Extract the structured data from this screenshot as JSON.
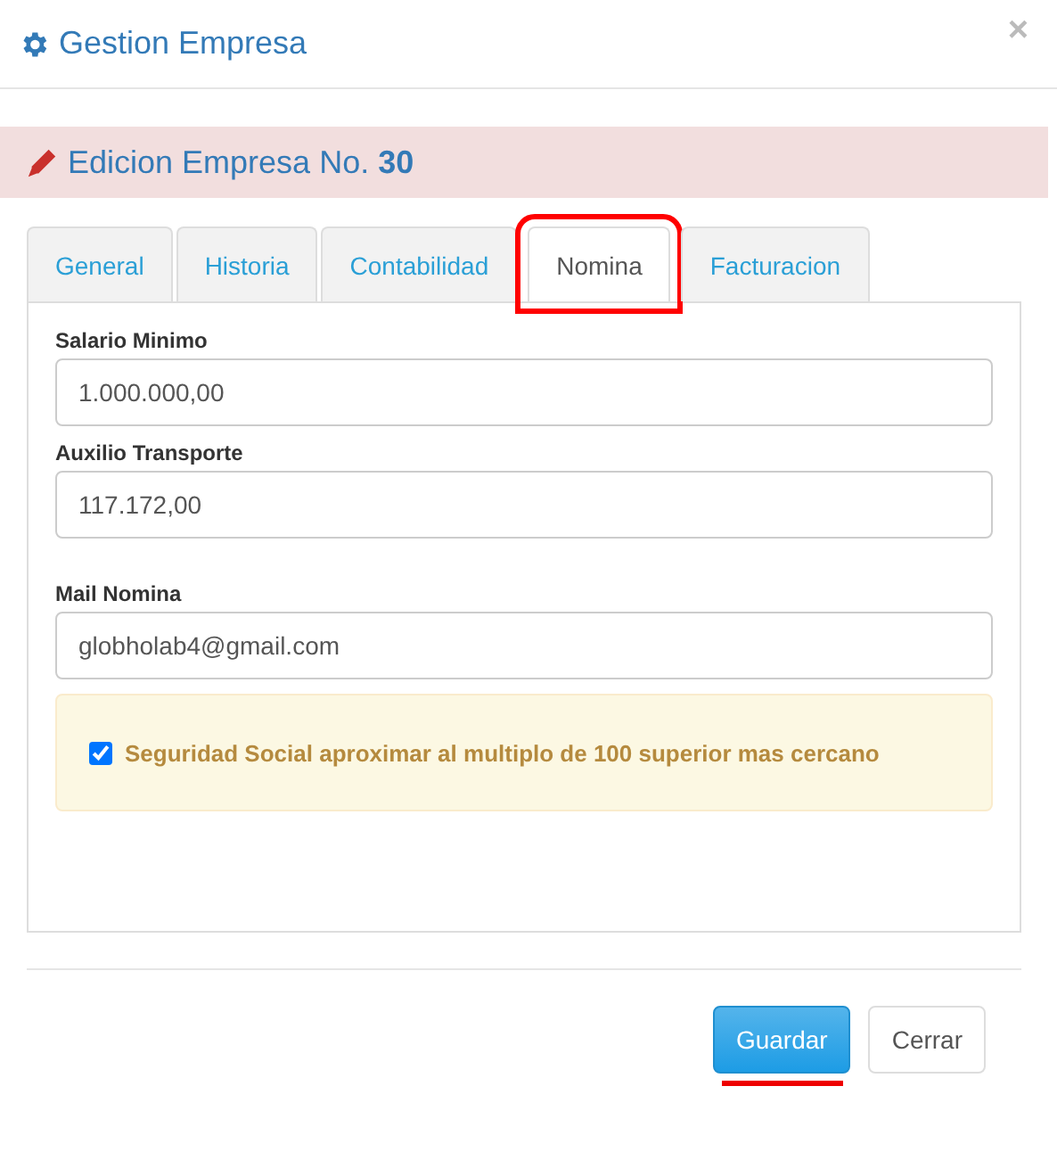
{
  "dialog": {
    "title": "Gestion Empresa",
    "close": "×"
  },
  "banner": {
    "text": "Edicion Empresa No. **30**"
  },
  "tabs": [
    {
      "label": "General",
      "selected": false,
      "highlighted": false
    },
    {
      "label": "Historia",
      "selected": false,
      "highlighted": false
    },
    {
      "label": "Contabilidad",
      "selected": false,
      "highlighted": false
    },
    {
      "label": "Nomina",
      "selected": true,
      "highlighted": true
    },
    {
      "label": "Facturacion",
      "selected": false,
      "highlighted": false
    }
  ],
  "fields": [
    {
      "label": "Salario Minimo",
      "value": "1.000.000,00"
    },
    {
      "label": "Auxilio Transporte",
      "value": "117.172,00"
    },
    {
      "label": "Mail Nomina",
      "value": "globholab4@gmail.com"
    }
  ],
  "option": {
    "label": "Seguridad Social aproximar al multiplo de 100 superior mas cercano",
    "checked": true
  },
  "buttons": [
    {
      "label": "Guardar",
      "kind": "primary",
      "underlined": true
    },
    {
      "label": "Cerrar",
      "kind": "default",
      "underlined": false
    }
  ]
}
